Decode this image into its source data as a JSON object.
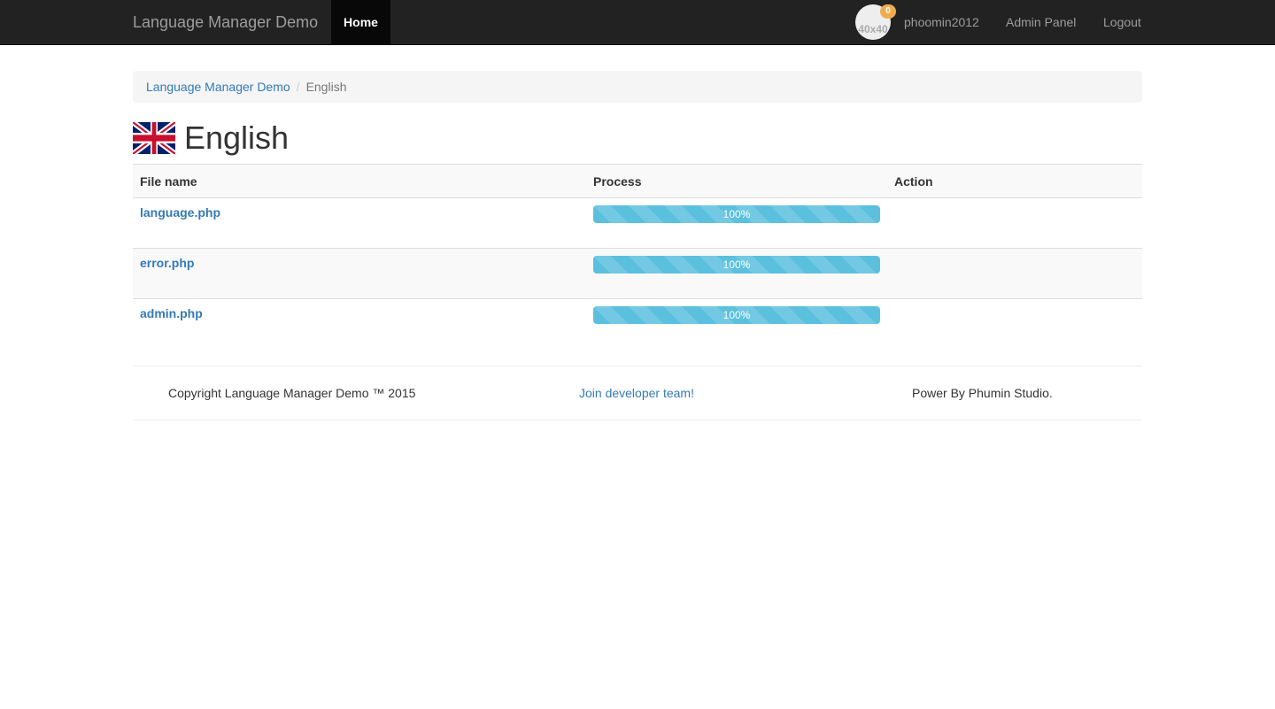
{
  "navbar": {
    "brand": "Language Manager Demo",
    "home_label": "Home",
    "avatar_placeholder": "40x40",
    "notification_count": "0",
    "username": "phoomin2012",
    "admin_panel_label": "Admin Panel",
    "logout_label": "Logout"
  },
  "breadcrumb": {
    "items": [
      {
        "label": "Language Manager Demo"
      },
      {
        "label": "English"
      }
    ],
    "separator": "/"
  },
  "page": {
    "title": "English",
    "flag_icon": "uk-flag-icon"
  },
  "table": {
    "columns": [
      "File name",
      "Process",
      "Action"
    ],
    "rows": [
      {
        "file": "language.php",
        "progress": 100,
        "progress_label": "100%"
      },
      {
        "file": "error.php",
        "progress": 100,
        "progress_label": "100%"
      },
      {
        "file": "admin.php",
        "progress": 100,
        "progress_label": "100%"
      }
    ]
  },
  "footer": {
    "copyright": "Copyright Language Manager Demo ™ 2015",
    "join_link": "Join developer team!",
    "powered_by": "Power By Phumin Studio."
  },
  "colors": {
    "navbar_bg": "#222222",
    "link": "#337ab7",
    "progress_info": "#5bc0de",
    "badge_warning": "#f0ad4e"
  }
}
